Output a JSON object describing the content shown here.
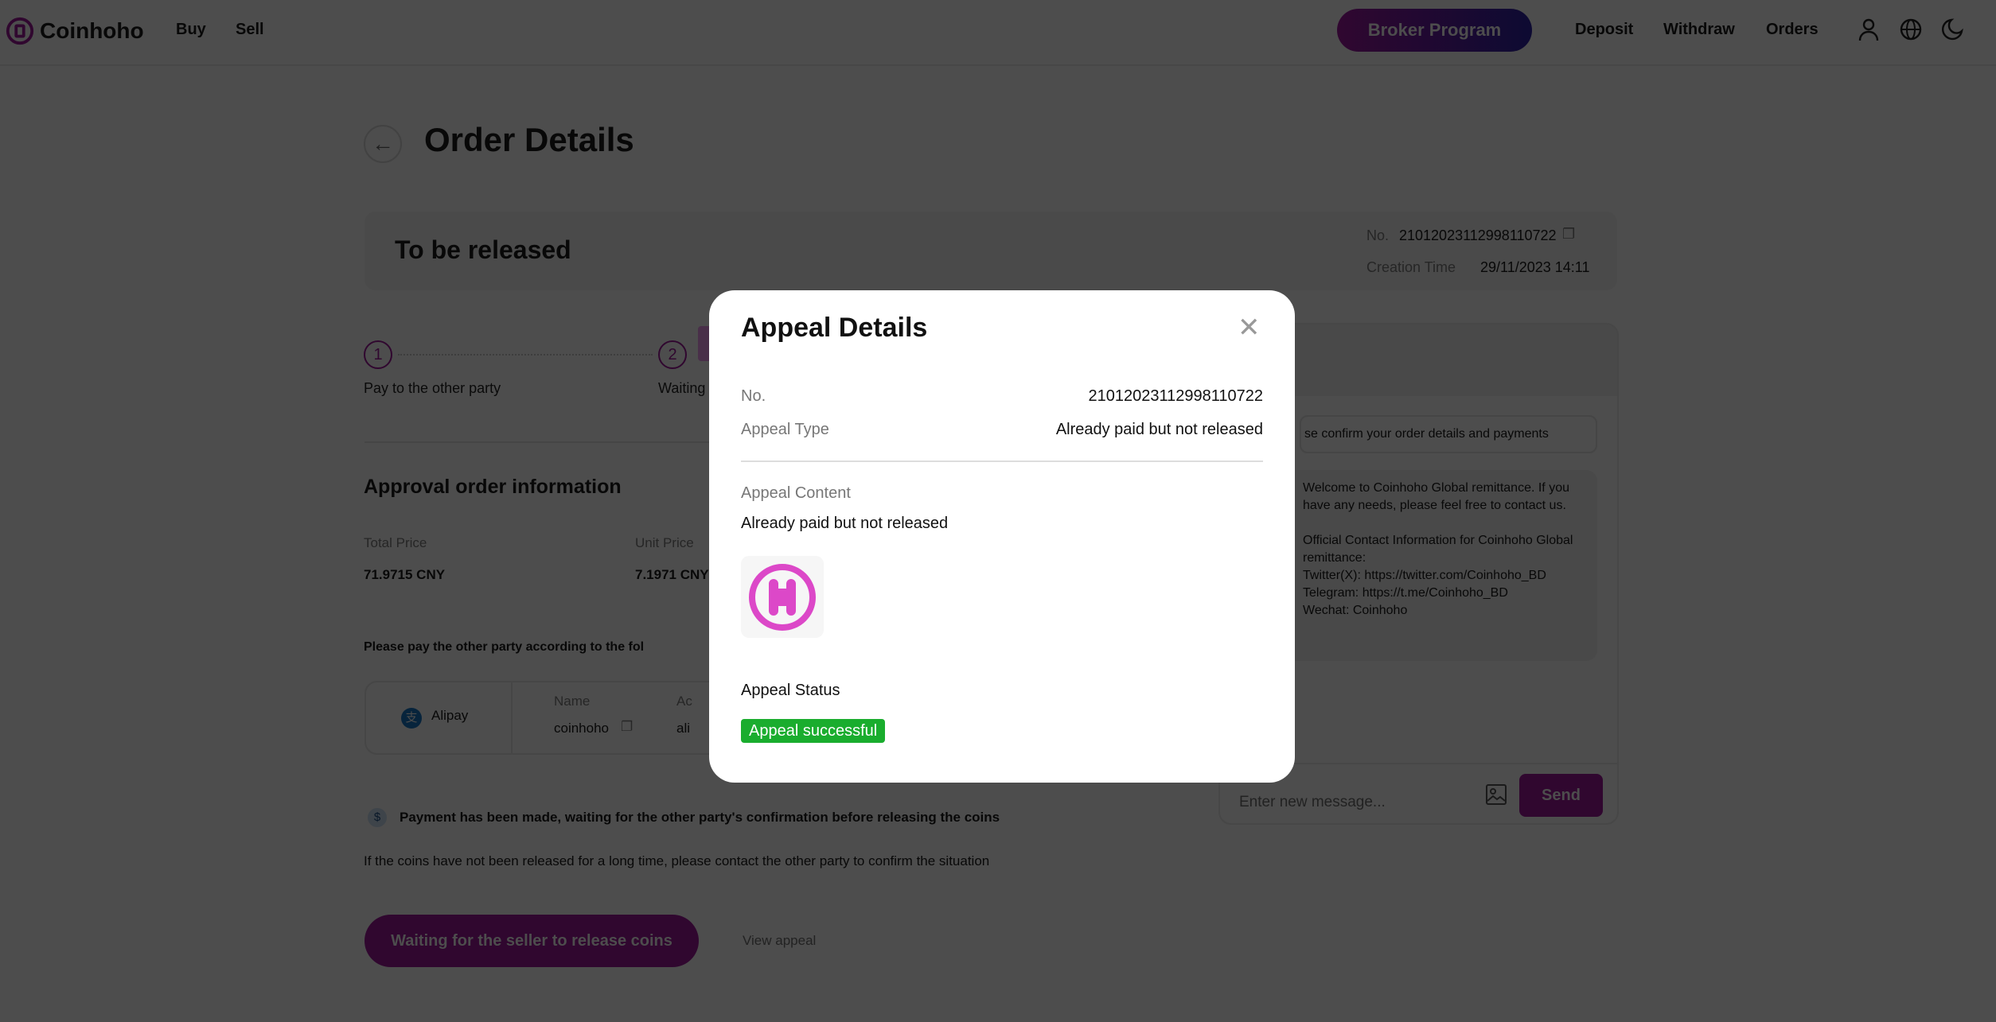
{
  "header": {
    "brand": "Coinhoho",
    "nav": [
      "Buy",
      "Sell"
    ],
    "broker": "Broker Program",
    "right_nav": [
      "Deposit",
      "Withdraw",
      "Orders"
    ],
    "icons": [
      "user-icon",
      "globe-icon",
      "moon-icon"
    ],
    "accent": "#a0169e"
  },
  "page": {
    "title": "Order Details",
    "status": "To be released",
    "no_label": "No.",
    "no_value": "21012023112998110722",
    "creation_label": "Creation Time",
    "creation_value": "29/11/2023 14:11"
  },
  "steps": [
    {
      "num": "1",
      "label": "Pay to the other party"
    },
    {
      "num": "2",
      "label": "Waiting"
    }
  ],
  "order_info": {
    "heading": "Approval order information",
    "total_label": "Total Price",
    "total_value": "71.9715 CNY",
    "unit_label": "Unit Price",
    "unit_value": "7.1971 CNY"
  },
  "payment": {
    "instruction": "Please pay the other party according to the fol",
    "method": "Alipay",
    "name_label": "Name",
    "name_value": "coinhoho",
    "account_label": "Ac",
    "account_value": "ali"
  },
  "notice": {
    "paid": "Payment has been made, waiting for the other party's confirmation before releasing the coins",
    "hint": "If the coins have not been released for a long time, please contact the other party to confirm the situation"
  },
  "actions": {
    "waiting": "Waiting for the seller to release coins",
    "view_appeal": "View appeal"
  },
  "chat": {
    "notice": "se confirm your order details and payments",
    "welcome": "Welcome to Coinhoho Global remittance. If you have any needs, please feel free to contact us.\n\nOfficial Contact Information for Coinhoho Global remittance:\nTwitter(X): https://twitter.com/Coinhoho_BD\nTelegram: https://t.me/Coinhoho_BD\nWechat: Coinhoho",
    "placeholder": "Enter new message...",
    "send": "Send"
  },
  "modal": {
    "title": "Appeal Details",
    "no_label": "No.",
    "no_value": "21012023112998110722",
    "type_label": "Appeal Type",
    "type_value": "Already paid but not released",
    "content_label": "Appeal Content",
    "content_value": "Already paid but not released",
    "status_label": "Appeal Status",
    "status_value": "Appeal successful",
    "status_color": "#1aad2e"
  }
}
